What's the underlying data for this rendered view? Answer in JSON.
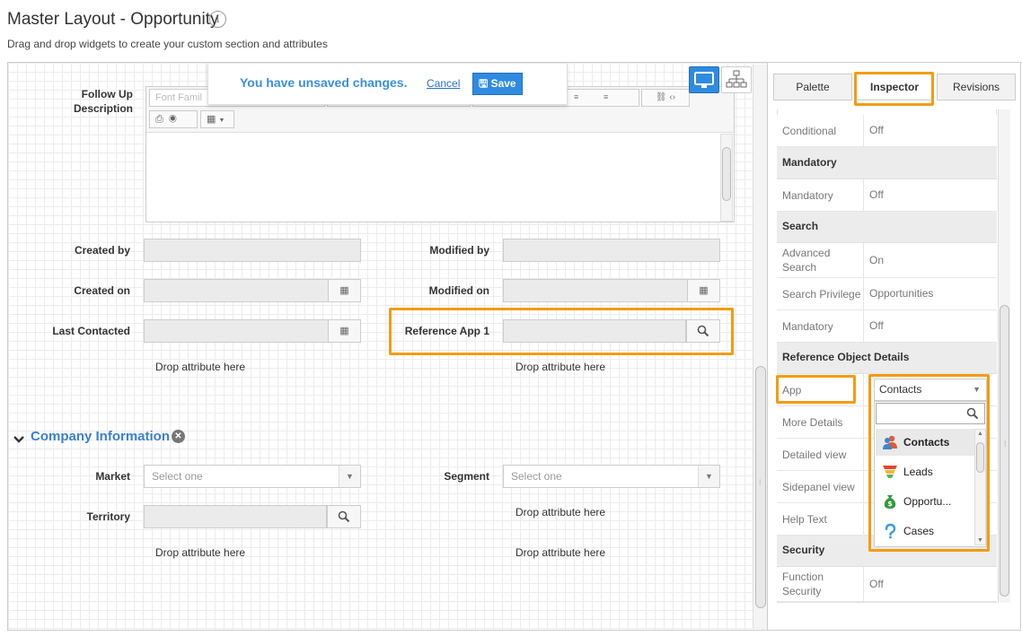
{
  "header": {
    "title": "Master Layout - Opportunity",
    "subtitle": "Drag and drop widgets to create your custom section and attributes"
  },
  "notification": {
    "message": "You have unsaved changes.",
    "cancel": "Cancel",
    "save": "Save"
  },
  "editor": {
    "toolbar_font_placeholder": "Font Famil",
    "label": "Follow Up Description"
  },
  "form": {
    "created_by": "Created by",
    "modified_by": "Modified by",
    "created_on": "Created on",
    "modified_on": "Modified on",
    "last_contacted": "Last Contacted",
    "reference_app": "Reference App 1",
    "drop_here": "Drop attribute here"
  },
  "company": {
    "section_title": "Company Information",
    "market": "Market",
    "segment": "Segment",
    "territory": "Territory",
    "select_placeholder": "Select one"
  },
  "tabs": {
    "palette": "Palette",
    "inspector": "Inspector",
    "revisions": "Revisions"
  },
  "inspector": {
    "conditional_k": "Conditional",
    "conditional_v": "Off",
    "mandatory_section": "Mandatory",
    "mandatory_k": "Mandatory",
    "mandatory_v": "Off",
    "search_section": "Search",
    "adv_search_k": "Advanced Search",
    "adv_search_v": "On",
    "search_priv_k": "Search Privilege",
    "search_priv_v": "Opportunities",
    "search_mand_k": "Mandatory",
    "search_mand_v": "Off",
    "ref_section": "Reference Object Details",
    "app_k": "App",
    "app_v": "Contacts",
    "more_details_k": "More Details",
    "detailed_view_k": "Detailed view",
    "sidepanel_view_k": "Sidepanel view",
    "help_text_k": "Help Text",
    "security_section": "Security",
    "func_security_k": "Function Security",
    "func_security_v": "Off"
  },
  "app_dropdown": {
    "options": [
      "Contacts",
      "Leads",
      "Opportu...",
      "Cases"
    ]
  },
  "colors": {
    "accent": "#2f8be0",
    "highlight": "#f39c12",
    "link": "#3a8ee6"
  }
}
